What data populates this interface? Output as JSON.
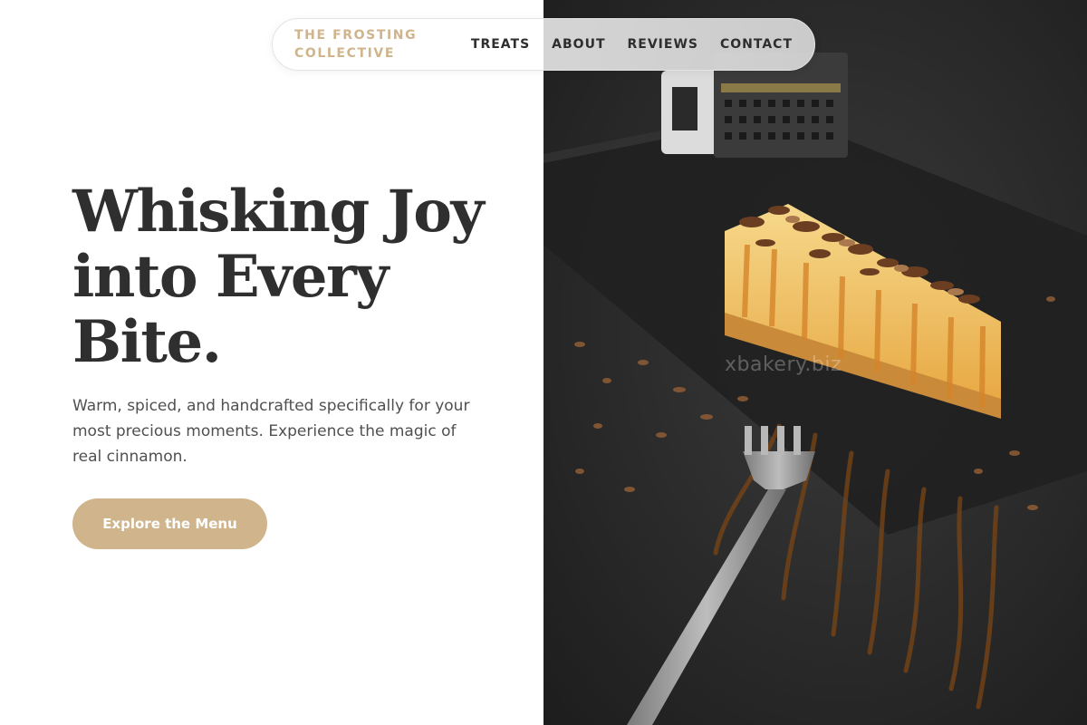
{
  "brand": {
    "line1": "THE FROSTING",
    "line2": "COLLECTIVE",
    "color": "#cfb48c"
  },
  "nav": {
    "links": [
      "TREATS",
      "ABOUT",
      "REVIEWS",
      "CONTACT"
    ]
  },
  "hero": {
    "title_lines": [
      "Whisking Joy",
      "into Every",
      "Bite."
    ],
    "text": "Warm, spiced, and handcrafted specifically for your most precious moments. Experience the magic of real cinnamon.",
    "cta_label": "Explore the Menu",
    "cta_color": "#cfb48c"
  },
  "photo": {
    "subject": "cheesecake-slice-with-caramel-and-chocolate-shavings",
    "watermark": "xbakery.biz"
  }
}
